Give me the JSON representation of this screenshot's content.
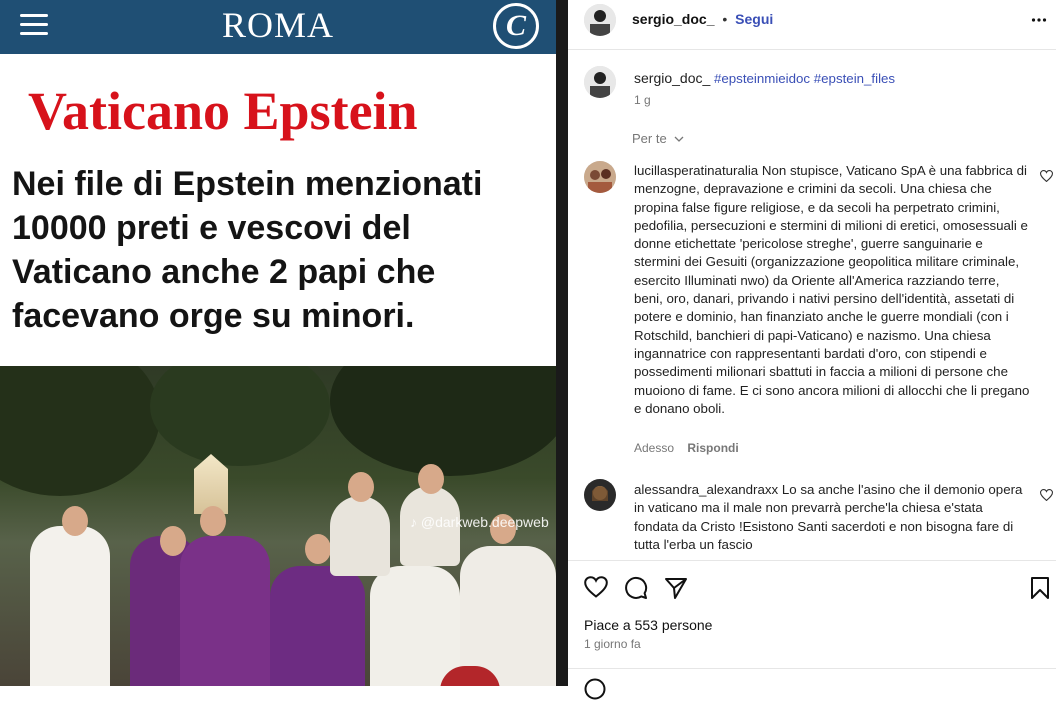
{
  "post_image": {
    "brand": "ROMA",
    "brand_logo_letter": "C",
    "headline_red": "Vaticano Epstein",
    "headline_lines": [
      "Nei file di Epstein menzionati",
      "10000 preti e vescovi del",
      "Vaticano anche 2 papi che",
      "facevano orge su minori."
    ],
    "watermark": "♪ @darkweb.deepweb"
  },
  "header": {
    "username": "sergio_doc_",
    "dot": "•",
    "follow_label": "Segui",
    "more_icon": "more-horizontal-icon"
  },
  "caption": {
    "username": "sergio_doc_",
    "hashtags": "#epsteinmieidoc #epstein_files",
    "time": "1 g"
  },
  "translate_label": "Per te",
  "comments": [
    {
      "username": "lucillasperatinaturalia",
      "text": "Non stupisce, Vaticano SpA è una fabbrica di menzogne, depravazione e crimini da secoli. Una chiesa che propina false figure religiose, e da secoli ha perpetrato crimini, pedofilia, persecuzioni e stermini di milioni di eretici, omosessuali e donne etichettate 'pericolose streghe', guerre sanguinarie e stermini dei Gesuiti (organizzazione geopolitica militare criminale, esercito Illuminati nwo) da Oriente all'America razziando terre, beni, oro, danari, privando i nativi persino dell'identità, assetati di potere e dominio, han finanziato anche le guerre mondiali (con i Rotschild, banchieri di papi-Vaticano) e nazismo. Una chiesa ingannatrice con rappresentanti bardati d'oro, con stipendi e possedimenti milionari sbattuti in faccia a milioni di persone che muoiono di fame. E ci sono ancora milioni di allocchi che li pregano e donano oboli.",
      "time": "Adesso",
      "reply_label": "Rispondi"
    },
    {
      "username": "alessandra_alexandraxx",
      "text": "Lo sa anche l'asino che il demonio opera in vaticano ma il male non prevarrà perche'la chiesa e'stata fondata da Cristo !Esistono Santi sacerdoti e non bisogna fare di tutta l'erba un fascio"
    }
  ],
  "actions": {
    "like_icon": "heart-icon",
    "comment_icon": "comment-icon",
    "share_icon": "send-icon",
    "save_icon": "bookmark-icon"
  },
  "likes_text": "Piace a 553 persone",
  "date_text": "1 giorno fa",
  "colors": {
    "link": "#3a4fb6",
    "brand_bar": "#1f4f74",
    "headline_red": "#d7121b"
  }
}
